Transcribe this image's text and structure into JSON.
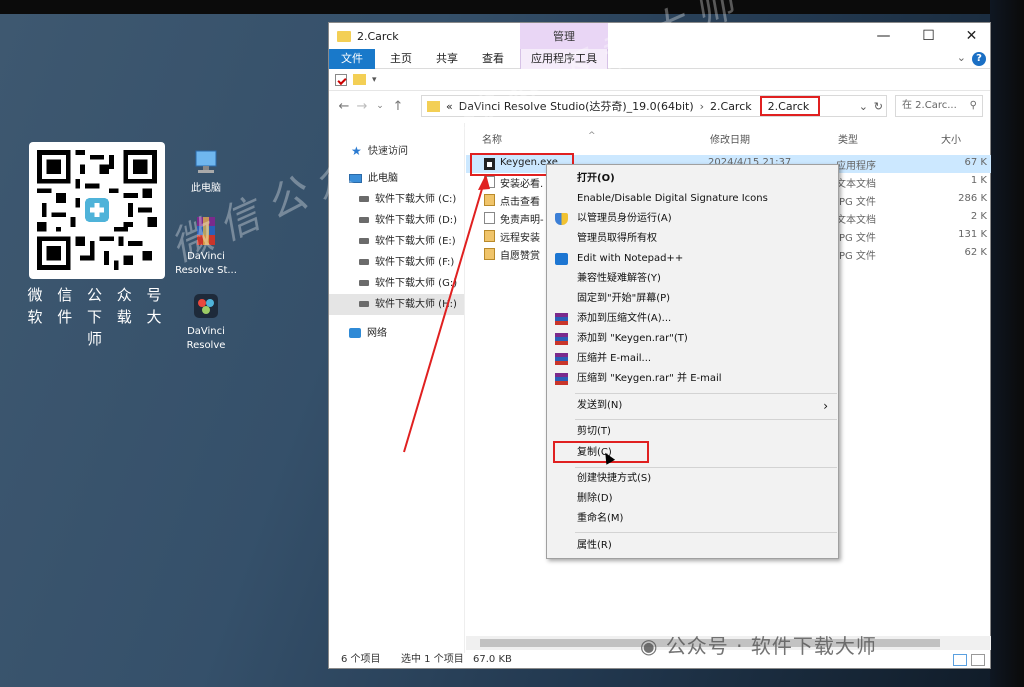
{
  "desktop": {
    "qr_caption_line1": "微 信 公 众 号",
    "qr_caption_line2": "软 件 下 载 大 师",
    "icons": [
      {
        "label": "此电脑"
      },
      {
        "label_line1": "DaVinci",
        "label_line2": "Resolve St..."
      },
      {
        "label_line1": "DaVinci",
        "label_line2": "Resolve"
      }
    ],
    "watermark": "微信公众号：软件下载大师",
    "watermark_bottom": "公众号 · 软件下载大师"
  },
  "window": {
    "title": "2.Carck",
    "manage_tab": "管理",
    "controls": {
      "minimize": "—",
      "maximize": "☐",
      "close": "✕"
    },
    "ribbon_tabs": [
      "文件",
      "主页",
      "共享",
      "查看",
      "应用程序工具"
    ],
    "help": "?",
    "address": {
      "chevron": "«",
      "segments": [
        "DaVinci Resolve Studio(达芬奇)_19.0(64bit)",
        "2.Carck"
      ],
      "current": "2.Carck",
      "separator": "›"
    },
    "search_placeholder": "在 2.Carc...",
    "nav_pane": [
      {
        "label": "快速访问",
        "icon": "star-icon"
      },
      {
        "label": "此电脑",
        "icon": "computer-icon"
      },
      {
        "label": "软件下载大师 (C:)",
        "icon": "drive-icon"
      },
      {
        "label": "软件下载大师 (D:)",
        "icon": "drive-icon"
      },
      {
        "label": "软件下载大师 (E:)",
        "icon": "drive-icon"
      },
      {
        "label": "软件下载大师 (F:)",
        "icon": "drive-icon"
      },
      {
        "label": "软件下载大师 (G:)",
        "icon": "drive-icon"
      },
      {
        "label": "软件下载大师 (H:)",
        "icon": "drive-icon",
        "selected": true
      },
      {
        "label": "网络",
        "icon": "network-icon"
      }
    ],
    "columns": {
      "name": "名称",
      "date": "修改日期",
      "type": "类型",
      "size": "大小"
    },
    "files": [
      {
        "name": "Keygen.exe",
        "date": "2024/4/15 21:37",
        "type": "应用程序",
        "size": "67 K",
        "kind": "exe",
        "selected": true
      },
      {
        "name": "安装必看.",
        "date": "",
        "type": "文本文档",
        "size": "1 K",
        "kind": "txt"
      },
      {
        "name": "点击查看",
        "date": "",
        "type": "JPG 文件",
        "size": "286 K",
        "kind": "img"
      },
      {
        "name": "免责声明-",
        "date": "",
        "type": "文本文档",
        "size": "2 K",
        "kind": "txt"
      },
      {
        "name": "远程安装",
        "date": "",
        "type": "JPG 文件",
        "size": "131 K",
        "kind": "img"
      },
      {
        "name": "自愿赞赏",
        "date": "",
        "type": "JPG 文件",
        "size": "62 K",
        "kind": "img"
      }
    ],
    "status": {
      "count": "6 个项目",
      "selection": "选中 1 个项目",
      "size": "67.0 KB"
    }
  },
  "context_menu": {
    "items": [
      {
        "label": "打开(O)",
        "bold": true
      },
      {
        "label": "Enable/Disable Digital Signature Icons"
      },
      {
        "label": "以管理员身份运行(A)",
        "icon": "shield-icon"
      },
      {
        "label": "管理员取得所有权"
      },
      {
        "label": "Edit with Notepad++",
        "icon": "notepad-icon"
      },
      {
        "label": "兼容性疑难解答(Y)"
      },
      {
        "label": "固定到\"开始\"屏幕(P)"
      },
      {
        "label": "添加到压缩文件(A)...",
        "icon": "winrar-icon"
      },
      {
        "label": "添加到 \"Keygen.rar\"(T)",
        "icon": "winrar-icon"
      },
      {
        "label": "压缩并 E-mail...",
        "icon": "winrar-icon"
      },
      {
        "label": "压缩到 \"Keygen.rar\" 并 E-mail",
        "icon": "winrar-icon"
      },
      {
        "label": "发送到(N)",
        "submenu": true
      },
      {
        "label": "剪切(T)"
      },
      {
        "label": "复制(C)"
      },
      {
        "label": "创建快捷方式(S)"
      },
      {
        "label": "删除(D)"
      },
      {
        "label": "重命名(M)"
      },
      {
        "label": "属性(R)"
      }
    ]
  },
  "colors": {
    "accent": "#1979ca",
    "highlight": "#e02020",
    "selection": "#cce8ff",
    "manage": "#e9d6f5"
  }
}
